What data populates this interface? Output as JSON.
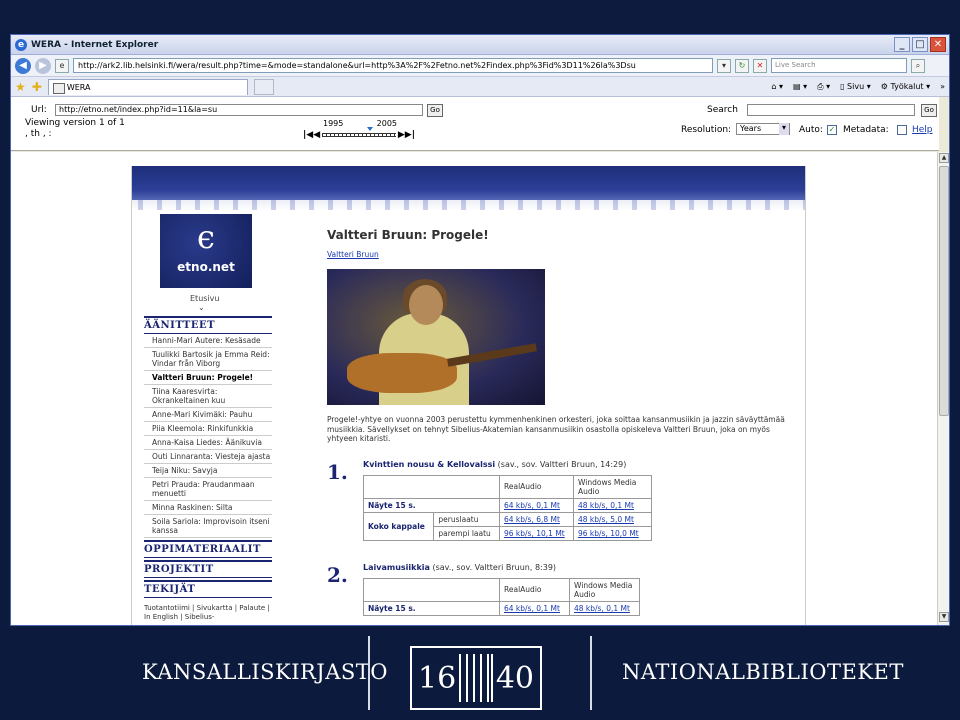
{
  "browser": {
    "window_title": "WERA - Internet Explorer",
    "address": "http://ark2.lib.helsinki.fi/wera/result.php?time=&mode=standalone&url=http%3A%2F%2Fetno.net%2Findex.php%3Fid%3D11%26la%3Dsu",
    "live_search_placeholder": "Live Search",
    "tab_label": "WERA",
    "cmd_page": "Sivu",
    "cmd_tools": "Työkalut",
    "min": "_",
    "max": "□",
    "close": "✕"
  },
  "wera": {
    "url_label": "Url:",
    "url_value": "http://etno.net/index.php?id=11&la=su",
    "go": "Go",
    "search_label": "Search",
    "search_go": "Go",
    "version_text": "Viewing version 1 of 1",
    "version_sub": ", th , :",
    "year_start": "1995",
    "year_end": "2005",
    "resolution_label": "Resolution:",
    "resolution_value": "Years",
    "auto_label": "Auto:",
    "metadata_label": "Metadata:",
    "help_link": "Help"
  },
  "site": {
    "logo_text": "etno.net",
    "etusivu": "Etusivu",
    "nav_sections": {
      "aanitteet": "ÄÄNITTEET",
      "oppimateriaalit": "OPPIMATERIAALIT",
      "projektit": "PROJEKTIT",
      "tekijat": "TEKIJÄT"
    },
    "nav_items": [
      "Hanni-Mari Autere: Kesäsade",
      "Tuulikki Bartosik ja Emma Reid: Vindar från Viborg",
      "Valtteri Bruun: Progele!",
      "Tiina Kaaresvirta: Okrankeltainen kuu",
      "Anne-Mari Kivimäki: Pauhu",
      "Piia Kleemola: Rinkifunkkia",
      "Anna-Kaisa Liedes: Äänikuvia",
      "Outi Linnaranta: Viesteja ajasta",
      "Teija Niku: Savyja",
      "Petri Prauda: Praudanmaan menuetti",
      "Minna Raskinen: Silta",
      "Soila Sariola: Improvisoin itseni kanssa"
    ],
    "nav_footer": "Tuotantotiimi | Sivukartta | Palaute | In English | Sibelius-",
    "page_title": "Valtteri Bruun: Progele!",
    "author_link": "Valtteri Bruun",
    "description": "Progele!-yhtye on vuonna 2003 perustettu kymmenhenkinen orkesteri, joka soittaa kansanmusiikin ja jazzin säväyttämää musiikkia. Sävellykset on tehnyt Sibelius-Akatemian kansanmusiikin osastolla opiskeleva Valtteri Bruun, joka on myös yhtyeen kitaristi.",
    "tracks": [
      {
        "num": "1.",
        "title": "Kvinttien nousu & Kellovalssi",
        "meta": "(sav., sov. Valtteri Bruun, 14:29)",
        "col_real": "RealAudio",
        "col_wm": "Windows Media Audio",
        "sample_label": "Näyte 15 s.",
        "sample_real": "64 kb/s, 0,1 Mt",
        "sample_wm": "48 kb/s, 0,1 Mt",
        "full_label": "Koko kappale",
        "q1": "peruslaatu",
        "q1_real": "64 kb/s, 6,8 Mt",
        "q1_wm": "48 kb/s, 5,0 Mt",
        "q2": "parempi laatu",
        "q2_real": "96 kb/s, 10,1 Mt",
        "q2_wm": "96 kb/s, 10,0 Mt"
      },
      {
        "num": "2.",
        "title": "Laivamusiikkia",
        "meta": "(sav., sov. Valtteri Bruun, 8:39)",
        "col_real": "RealAudio",
        "col_wm": "Windows Media Audio",
        "sample_label": "Näyte 15 s.",
        "sample_real": "64 kb/s, 0,1 Mt",
        "sample_wm": "48 kb/s, 0,1 Mt"
      }
    ]
  },
  "footer": {
    "left": "KANSALLISKIRJASTO",
    "crest_left": "16",
    "crest_right": "40",
    "right": "NATIONALBIBLIOTEKET"
  },
  "colors": {
    "slide_bg": "#0b1a3d",
    "site_blue": "#1a2470",
    "link": "#1a3ab0"
  }
}
